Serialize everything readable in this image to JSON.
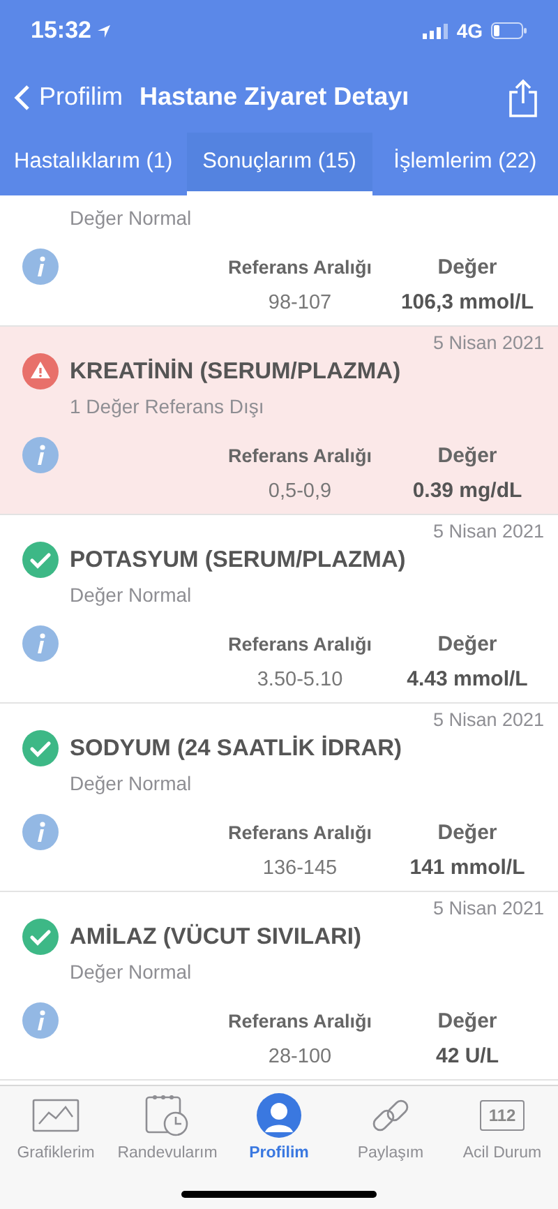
{
  "status_bar": {
    "time": "15:32",
    "network": "4G"
  },
  "nav": {
    "back": "Profilim",
    "title": "Hastane Ziyaret Detayı"
  },
  "tabs": [
    {
      "label": "Hastalıklarım (1)",
      "selected": false
    },
    {
      "label": "Sonuçlarım (15)",
      "selected": true
    },
    {
      "label": "İşlemlerim (22)",
      "selected": false
    }
  ],
  "results": [
    {
      "abnormal": false,
      "subtitle": "Değer Normal",
      "ref_label": "Referans Aralığı",
      "value_label": "Değer",
      "ref": "98-107",
      "value": "106,3 mmol/L"
    },
    {
      "abnormal": true,
      "date": "5 Nisan 2021",
      "title": "KREATİNİN (SERUM/PLAZMA)",
      "subtitle": "1 Değer Referans Dışı",
      "ref_label": "Referans Aralığı",
      "value_label": "Değer",
      "ref": "0,5-0,9",
      "value": "0.39 mg/dL"
    },
    {
      "abnormal": false,
      "date": "5 Nisan 2021",
      "title": "POTASYUM (SERUM/PLAZMA)",
      "subtitle": "Değer Normal",
      "ref_label": "Referans Aralığı",
      "value_label": "Değer",
      "ref": "3.50-5.10",
      "value": "4.43 mmol/L"
    },
    {
      "abnormal": false,
      "date": "5 Nisan 2021",
      "title": "SODYUM (24 SAATLİK İDRAR)",
      "subtitle": "Değer Normal",
      "ref_label": "Referans Aralığı",
      "value_label": "Değer",
      "ref": "136-145",
      "value": "141 mmol/L"
    },
    {
      "abnormal": false,
      "date": "5 Nisan 2021",
      "title": "AMİLAZ (VÜCUT SIVILARI)",
      "subtitle": "Değer Normal",
      "ref_label": "Referans Aralığı",
      "value_label": "Değer",
      "ref": "28-100",
      "value": "42 U/L"
    }
  ],
  "bottom_tabs": [
    {
      "kind": "chart",
      "label": "Grafiklerim",
      "selected": false
    },
    {
      "kind": "calendar",
      "label": "Randevularım",
      "selected": false
    },
    {
      "kind": "profile",
      "label": "Profilim",
      "selected": true
    },
    {
      "kind": "link",
      "label": "Paylaşım",
      "selected": false
    },
    {
      "kind": "emergency",
      "label": "Acil Durum",
      "selected": false,
      "icon_text": "112"
    }
  ]
}
